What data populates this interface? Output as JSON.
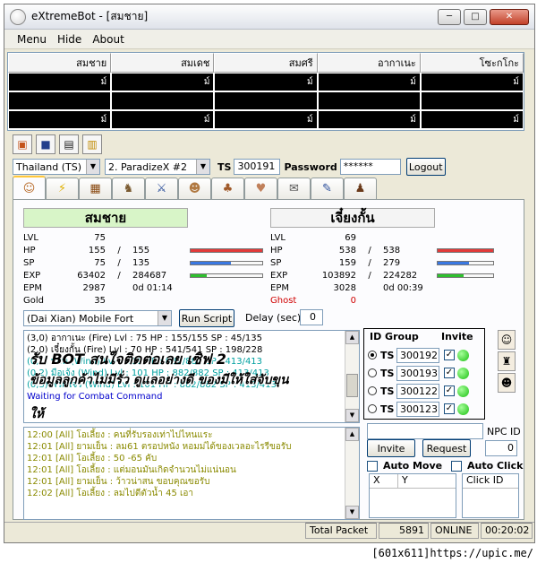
{
  "window": {
    "title": "eXtremeBot - [สมชาย]",
    "btn_min": "─",
    "btn_max": "□",
    "btn_close": "✕"
  },
  "menu": [
    "Menu",
    "Hide",
    "About"
  ],
  "party_grid": {
    "headers": [
      "สมชาย",
      "สมเดช",
      "สมศรี",
      "อากาเนะ",
      "โซะกโกะ"
    ],
    "rows": [
      [
        "ม์",
        "ม์",
        "ม์",
        "ม์",
        "ม์"
      ],
      [
        "",
        "",
        "",
        "",
        ""
      ],
      [
        "ม์",
        "ม์",
        "ม์",
        "ม์",
        "ม์"
      ]
    ]
  },
  "toolbar_icons": [
    "open-icon",
    "save-icon",
    "computer-icon",
    "chat-icon"
  ],
  "server": {
    "region": "Thailand (TS)",
    "server": "2. ParadizeX #2",
    "ts_label": "TS",
    "ts_value": "300191",
    "password_label": "Password",
    "password_value": "******",
    "logout": "Logout"
  },
  "tabs": [
    {
      "name": "character-tab",
      "glyph": "🧍"
    },
    {
      "name": "skill-tab",
      "glyph": "⚡"
    },
    {
      "name": "item-tab",
      "glyph": "📦"
    },
    {
      "name": "pet-tab",
      "glyph": "🐉"
    },
    {
      "name": "battle-tab",
      "glyph": "⚔"
    },
    {
      "name": "party-tab",
      "glyph": "👥"
    },
    {
      "name": "team-tab",
      "glyph": "👨‍👩‍👧"
    },
    {
      "name": "trade-tab",
      "glyph": "🤝"
    },
    {
      "name": "mail-tab",
      "glyph": "✉"
    },
    {
      "name": "tools-tab",
      "glyph": "🔧"
    },
    {
      "name": "walk-tab",
      "glyph": "🚶"
    }
  ],
  "player": {
    "name": "สมชาย",
    "lvl": "75",
    "hp": "155",
    "hp_max": "155",
    "sp": "75",
    "sp_max": "135",
    "exp": "63402",
    "exp_max": "284687",
    "epm": "2987",
    "time": "0d 01:14",
    "gold": "35",
    "hp_fill": 1.0,
    "sp_fill": 0.56,
    "exp_fill": 0.22
  },
  "pet": {
    "name": "เจี๋ยงกั้น",
    "lvl": "69",
    "hp": "538",
    "hp_max": "538",
    "sp": "159",
    "sp_max": "279",
    "exp": "103892",
    "exp_max": "224282",
    "epm": "3028",
    "time": "0d 00:39",
    "ghost": "0",
    "hp_fill": 1.0,
    "sp_fill": 0.57,
    "exp_fill": 0.46
  },
  "labels": {
    "lvl": "LVL",
    "hp": "HP",
    "sp": "SP",
    "exp": "EXP",
    "epm": "EPM",
    "gold": "Gold",
    "ghost": "Ghost",
    "slash": "/"
  },
  "script": {
    "select": "(Dai Xian)  Mobile Fort",
    "run": "Run Script",
    "delay_label": "Delay (sec)",
    "delay_value": "0"
  },
  "battle_log": [
    {
      "text": "(3,0)  อากาเนะ  (Fire)  Lvl : 75 HP : 155/155  SP : 45/135",
      "color": "#000000"
    },
    {
      "text": "(2,0)  เจี๋ยงกั้น  (Fire)  Lvl : 70 HP : 541/541  SP : 198/228",
      "color": "#000000"
    },
    {
      "text": "(0,1)  บอท  (Wind)  Lvl : 101 HP : 882/882  SP : 413/413",
      "color": "#00a0a0"
    },
    {
      "text": "(0,2)  มือเจ้ง  (Wind)  Lvl : 101 HP : 882/882  SP : 413/413",
      "color": "#00a0a0"
    },
    {
      "text": "(0,3)  พวกโจร  (Wind)  Lvl : 101 HP : 882/882  SP : 413/413",
      "color": "#00a0a0"
    },
    {
      "text": "Waiting for Combat Command",
      "color": "#0000cc"
    }
  ],
  "overlay": {
    "line1": "รับ BOT สนใจติดต่อเลย เซิฟ 2",
    "line2": "ข้อมูลลูกค้าไม่มีรั่ว ดูแลอย่างดี ของมีให้ใส่จับขุน",
    "line3": "ให้"
  },
  "id_group": {
    "title": "ID Group",
    "invite_label": "Invite",
    "rows": [
      {
        "ts": "TS",
        "value": "300192",
        "selected": true
      },
      {
        "ts": "TS",
        "value": "300193",
        "selected": false
      },
      {
        "ts": "TS",
        "value": "300122",
        "selected": false
      },
      {
        "ts": "TS",
        "value": "300123",
        "selected": false
      }
    ]
  },
  "npc": {
    "label": "NPC ID",
    "invite": "Invite",
    "request": "Request",
    "value": "0"
  },
  "chat_log": [
    "12:00 [All] โอเลี้ยง : คนที่รับรองเท่าไปไหนแระ",
    "12:01 [All] ยามเย็น : ลม61  ตรอปหนัง หอมม่ได้ของเวลอะไรรีขอรับ",
    "12:01 [All] โอเลี้ยง : 50 -65 คับ",
    "12:01 [All] โอเลี้ยง : แต่มอนมันเกิดจำนวนไม่แน่นอน",
    "12:01 [All] ยามเย็น : ว้าวน่าสน  ขอบคุณขอรับ",
    "12:02 [All] โอเลี้ยง : ลมไปตีตัวน้ำ 45 เอา"
  ],
  "auto": {
    "move": "Auto Move",
    "click": "Auto Click",
    "x": "X",
    "y": "Y",
    "click_id": "Click ID"
  },
  "status": {
    "total_label": "Total Packet",
    "total_value": "5891",
    "online": "ONLINE",
    "time": "00:20:02"
  },
  "footer": "[601x611]https://upic.me/",
  "colors": {
    "hp_bar": "#e23a3a",
    "sp_bar": "#3a78e2",
    "exp_bar": "#2ec02e",
    "player_header": "#d8f5c8",
    "pet_header": "#f4f4f4",
    "log_green": "#8a8a00",
    "ghost": "#d00000"
  }
}
